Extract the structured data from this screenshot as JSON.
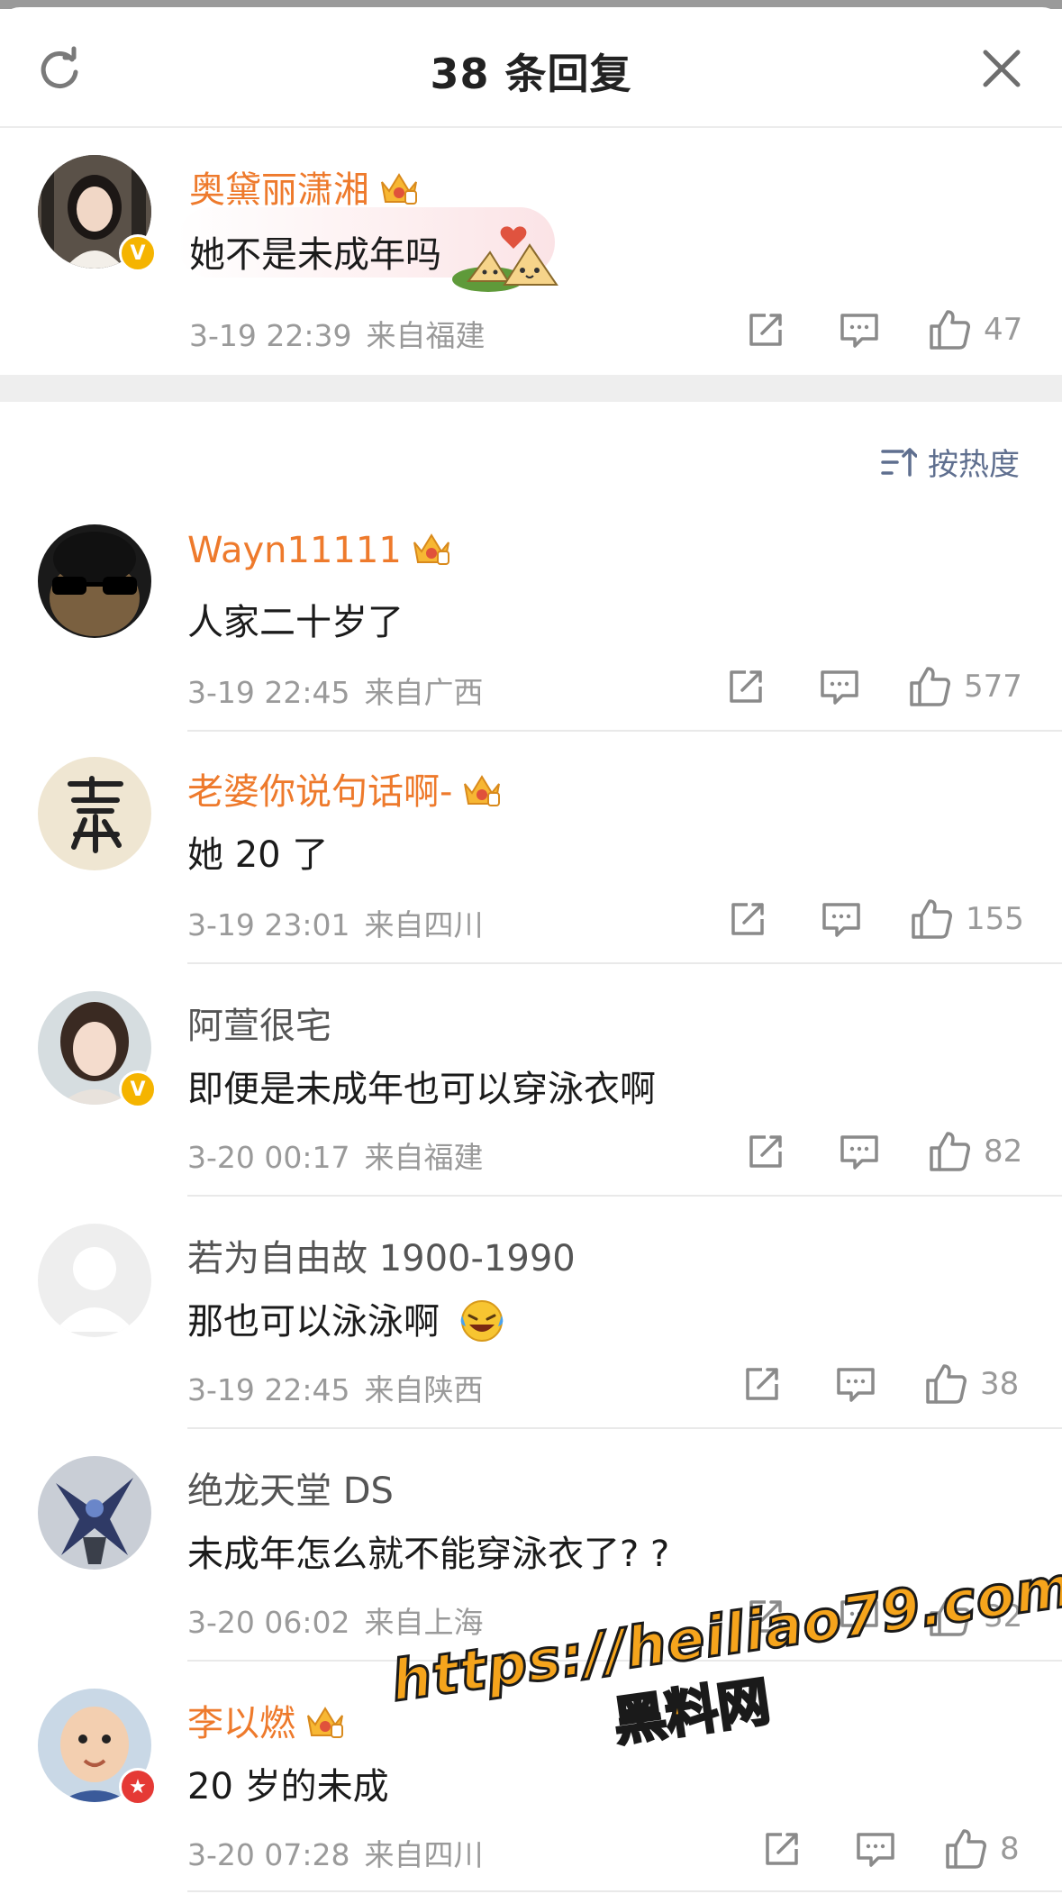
{
  "header": {
    "title": "38 条回复"
  },
  "root_comment": {
    "username": "奥黛丽潇湘",
    "text": "她不是未成年吗",
    "time": "3-19 22:39",
    "location": "来自福建",
    "likes": "47",
    "verified": true,
    "emoji": "zongzi-couple-sticker"
  },
  "sort": {
    "label": "按热度"
  },
  "replies": [
    {
      "username": "Wayn11111",
      "vip": true,
      "text": "人家二十岁了",
      "time": "3-19 22:45",
      "location": "来自广西",
      "likes": "577"
    },
    {
      "username": "老婆你说句话啊-",
      "vip": true,
      "text": "她 20 了",
      "time": "3-19 23:01",
      "location": "来自四川",
      "likes": "155"
    },
    {
      "username": "阿萱很宅",
      "vip": false,
      "verified": true,
      "text": "即便是未成年也可以穿泳衣啊",
      "time": "3-20 00:17",
      "location": "来自福建",
      "likes": "82"
    },
    {
      "username": "若为自由故 1900-1990",
      "vip": false,
      "text": "那也可以泳泳啊",
      "emoji": "laughing-crying-emoji",
      "time": "3-19 22:45",
      "location": "来自陕西",
      "likes": "38"
    },
    {
      "username": "绝龙天堂 DS",
      "vip": false,
      "text": "未成年怎么就不能穿泳衣了? ?",
      "time": "3-20 06:02",
      "location": "来自上海",
      "likes": "32"
    },
    {
      "username": "李以燃",
      "vip": true,
      "text": "20 岁的未成",
      "time": "3-20 07:28",
      "location": "来自四川",
      "likes": "8"
    }
  ],
  "watermark": {
    "url": "https://heiliao79.com",
    "name": "黑料网"
  },
  "colors": {
    "vip_name": "#ee7a2c",
    "meta": "#9a9a9a",
    "sort": "#5f6f8f",
    "verified_badge": "#f5b400"
  }
}
